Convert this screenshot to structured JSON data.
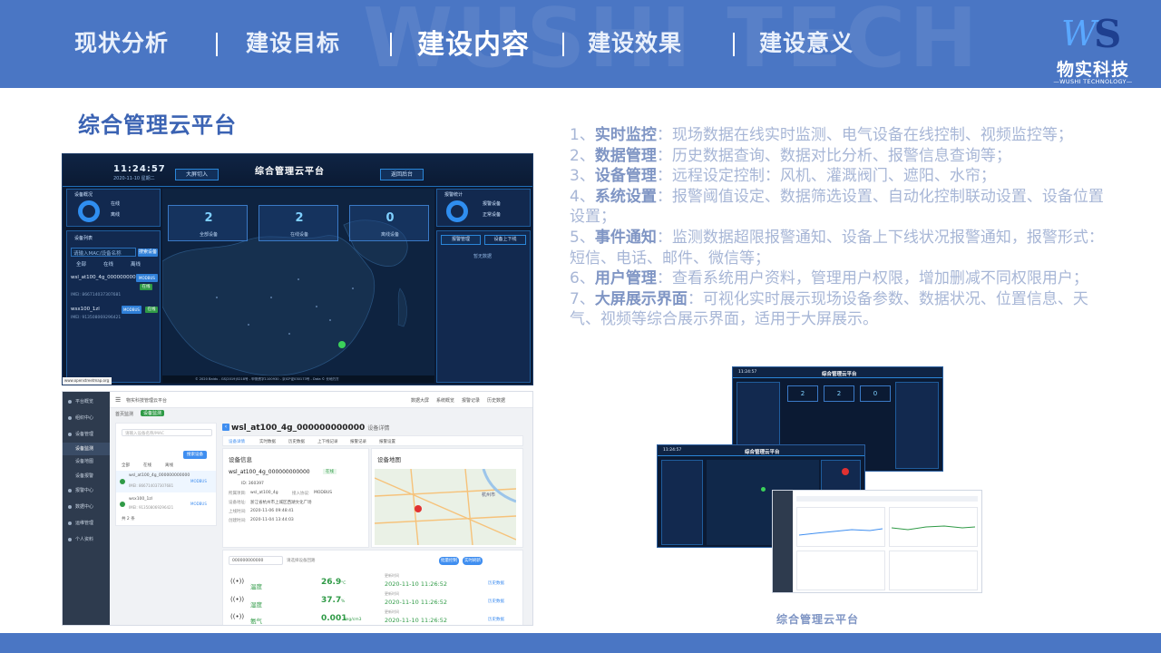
{
  "nav": {
    "items": [
      {
        "label": "现状分析",
        "active": false
      },
      {
        "label": "建设目标",
        "active": false
      },
      {
        "label": "建设内容",
        "active": true
      },
      {
        "label": "建设效果",
        "active": false
      },
      {
        "label": "建设意义",
        "active": false
      }
    ],
    "separator": "|"
  },
  "logo": {
    "mark": "WS",
    "name": "物实科技",
    "sub": "—WUSHI TECHNOLOGY—"
  },
  "section_title": "综合管理云平台",
  "dashboard": {
    "time": "11:24:57",
    "date": "2020-11-10 星期二",
    "title": "综合管理云平台",
    "tabs": [
      "大屏切入",
      "返回后台"
    ],
    "left_panel_title": "设备概况",
    "left_legend": [
      "在线",
      "离线"
    ],
    "device_list_title": "设备列表",
    "search_value": "请输入MAC/设备名称",
    "search_btn": "搜索设备",
    "filters": [
      "全部",
      "在线",
      "离线"
    ],
    "devices": [
      {
        "name": "wsl_at100_4g_000000000000",
        "mac": "IMEI: 866714037307681",
        "btn": "MODBUS",
        "status": "在线"
      },
      {
        "name": "wsx100_1zl",
        "mac": "IMEI: 913508069296421",
        "btn": "MODBUS",
        "status": "在线"
      }
    ],
    "stats": [
      {
        "value": "2",
        "label": "全部设备"
      },
      {
        "value": "2",
        "label": "在线设备"
      },
      {
        "value": "0",
        "label": "离线设备"
      }
    ],
    "right_panel_title": "报警统计",
    "right_legend": [
      "报警设备",
      "正常设备"
    ],
    "right_tabs": [
      "报警管理",
      "设备上下线"
    ],
    "right_empty": "暂无数据",
    "map_credit": "© 2020 Baidu - GS(2019)5218号 - 甲测资字1100930 - 京ICP证030173号 - Data © 长地万方",
    "map_url": "www.openstreetmap.org"
  },
  "detail": {
    "sidebar": [
      {
        "label": "平台概览",
        "active": false
      },
      {
        "label": "组织中心",
        "active": false
      },
      {
        "label": "设备管理",
        "active": false
      },
      {
        "label": "设备监测",
        "active": true
      },
      {
        "label": "设备地图",
        "active": false
      },
      {
        "label": "设备报警",
        "active": false
      },
      {
        "label": "报警中心",
        "active": false
      },
      {
        "label": "数据中心",
        "active": false
      },
      {
        "label": "运维管理",
        "active": false
      },
      {
        "label": "个人资料",
        "active": false
      }
    ],
    "app_title": "物实科技管理云平台",
    "topbar_links": [
      "数据大屏",
      "系统概览",
      "报警记录",
      "历史数据"
    ],
    "breadcrumb": [
      "首页监测",
      "设备监测"
    ],
    "device_title": "wsl_at100_4g_000000000000",
    "device_title_suffix": "设备详情",
    "tabs": [
      "设备详情",
      "实时数据",
      "历史数据",
      "上下线记录",
      "报警记录",
      "报警设置"
    ],
    "info_title": "设备信息",
    "map_title": "设备地图",
    "info_device_name": "wsl_at100_4g_000000000000",
    "info_status": "在线",
    "info_id": "ID: 360397",
    "info_group_label": "所属项目:",
    "info_group": "wsl_at100_4g",
    "info_protocol_label": "接入协议:",
    "info_protocol": "MODBUS",
    "info_addr_label": "设备地址:",
    "info_addr": "浙江省杭州市上城区西湖文化广场",
    "info_online_label": "上线时间:",
    "info_online": "2020-11-06 09:48:41",
    "info_create_label": "创建时间:",
    "info_create": "2020-11-04 13:44:03",
    "select_value": "000000000000",
    "select_hint": "请选择设备回路",
    "buttons": [
      "批量控制",
      "实时刷新"
    ],
    "readings": [
      {
        "label": "温度",
        "value": "26.9",
        "unit": "°C",
        "time_label": "更新时间",
        "time": "2020-11-10 11:26:52",
        "action": "历史数据"
      },
      {
        "label": "湿度",
        "value": "37.7",
        "unit": "%",
        "time_label": "更新时间",
        "time": "2020-11-10 11:26:52",
        "action": "历史数据"
      },
      {
        "label": "氨气",
        "value": "0.001",
        "unit": "mg/cm3",
        "time_label": "更新时间",
        "time": "2020-11-10 11:26:52",
        "action": "历史数据"
      }
    ],
    "list_search": "请输入设备名称/MAC",
    "list_btn": "搜索设备",
    "list_devices": [
      {
        "name": "wsl_at100_4g_000000000000",
        "mac": "IMEI: 866714037307681",
        "btn": "MODBUS"
      },
      {
        "name": "wsx100_1zl",
        "mac": "IMEI: 913508069296421",
        "btn": "MODBUS"
      }
    ],
    "list_filters": [
      "全部",
      "在线",
      "离线"
    ],
    "pager": "共 2 条",
    "map_place": "杭州市"
  },
  "features": [
    {
      "num": "1、",
      "key": "实时监控",
      "text": "：现场数据在线实时监测、电气设备在线控制、视频监控等；"
    },
    {
      "num": "2、",
      "key": "数据管理",
      "text": "：历史数据查询、数据对比分析、报警信息查询等；"
    },
    {
      "num": "3、",
      "key": "设备管理",
      "text": "：远程设定控制：风机、灌溉阀门、遮阳、水帘；"
    },
    {
      "num": "4、",
      "key": "系统设置",
      "text": "：报警阈值设定、数据筛选设置、自动化控制联动设置、设备位置设置；"
    },
    {
      "num": "5、",
      "key": "事件通知",
      "text": "：监测数据超限报警通知、设备上下线状况报警通知，报警形式：短信、电话、邮件、微信等；"
    },
    {
      "num": "6、",
      "key": "用户管理",
      "text": "：查看系统用户资料，管理用户权限，增加删减不同权限用户；"
    },
    {
      "num": "7、",
      "key": "大屏展示界面",
      "text": "：可视化实时展示现场设备参数、数据状况、位置信息、天气、视频等综合展示界面，适用于大屏展示。"
    }
  ],
  "composite": {
    "title": "综合管理云平台",
    "time": "11:24:57",
    "stats": [
      "2",
      "2",
      "0"
    ],
    "caption": "综合管理云平台"
  },
  "colors": {
    "header_bg": "#4a76c4",
    "accent": "#3b63b3",
    "feature_text": "#a7b6d6",
    "dark_bg": "#0b1a33",
    "online_green": "#2f9a46"
  }
}
